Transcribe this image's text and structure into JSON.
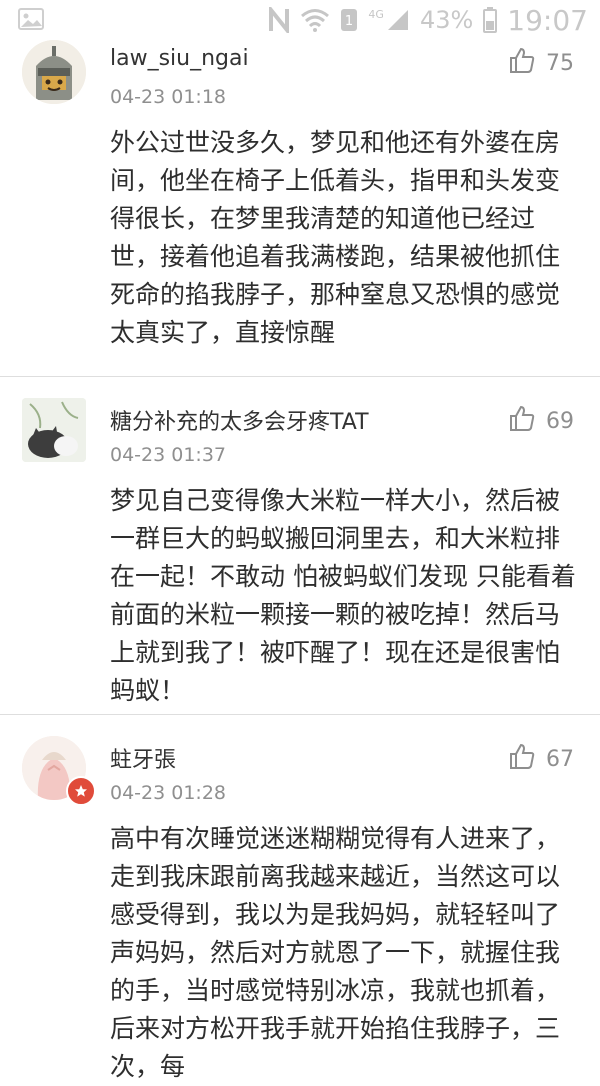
{
  "status_bar": {
    "network": "4G",
    "battery": "43%",
    "time": "19:07",
    "icons": [
      "image-icon",
      "nfc-icon",
      "wifi-icon",
      "sim-icon",
      "signal-icon",
      "battery-icon"
    ]
  },
  "comments": [
    {
      "username": "law_siu_ngai",
      "timestamp": "04-23 01:18",
      "likes": "75",
      "avatar": "knight-avatar",
      "text": "外公过世没多久，梦见和他还有外婆在房间，他坐在椅子上低着头，指甲和头发变得很长，在梦里我清楚的知道他已经过世，接着他追着我满楼跑，结果被他抓住死命的掐我脖子，那种窒息又恐惧的感觉太真实了，直接惊醒"
    },
    {
      "username": "糖分补充的太多会牙疼TAT",
      "timestamp": "04-23 01:37",
      "likes": "69",
      "avatar": "cat-avatar",
      "text": "梦见自己变得像大米粒一样大小，然后被一群巨大的蚂蚁搬回洞里去，和大米粒排在一起！不敢动 怕被蚂蚁们发现 只能看着前面的米粒一颗接一颗的被吃掉！然后马上就到我了！被吓醒了！现在还是很害怕蚂蚁！"
    },
    {
      "username": "蛀牙張",
      "timestamp": "04-23 01:28",
      "likes": "67",
      "avatar": "girl-avatar",
      "text": "高中有次睡觉迷迷糊糊觉得有人进来了，走到我床跟前离我越来越近，当然这可以感受得到，我以为是我妈妈，就轻轻叫了声妈妈，然后对方就恩了一下，就握住我的手，当时感觉特别冰凉，我就也抓着，后来对方松开我手就开始掐住我脖子，三次，每"
    }
  ],
  "theme": {
    "text": "#2e2e2e",
    "meta": "#8f8f8f",
    "divider": "#dedede",
    "badge": "#e04b3a"
  }
}
